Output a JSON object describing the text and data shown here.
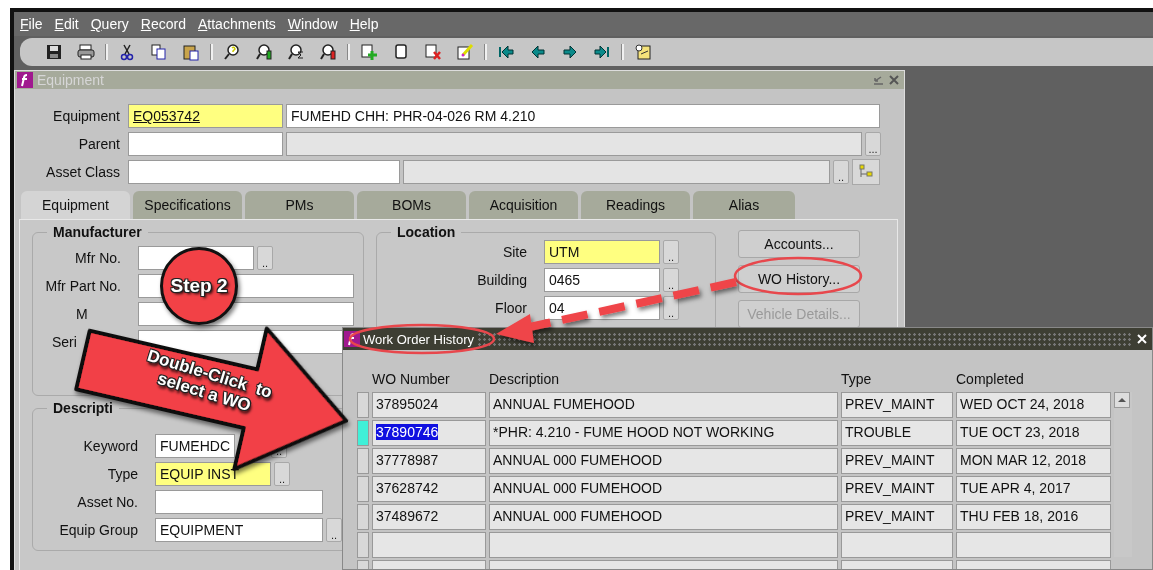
{
  "menu": [
    {
      "label": "File"
    },
    {
      "label": "Edit"
    },
    {
      "label": "Query"
    },
    {
      "label": "Record"
    },
    {
      "label": "Attachments"
    },
    {
      "label": "Window"
    },
    {
      "label": "Help"
    }
  ],
  "equipment_window": {
    "title": "Equipment",
    "header_rows": [
      {
        "label": "Equipment",
        "fields": [
          {
            "value": "EQ053742",
            "required": true,
            "disabled": false,
            "link": true
          },
          {
            "value": "FUMEHD CHH: PHR-04-026 RM 4.210",
            "required": false,
            "disabled": false
          }
        ]
      },
      {
        "label": "Parent",
        "fields": [
          {
            "required": false,
            "disabled": false
          },
          {
            "required": false,
            "disabled": true
          }
        ],
        "lov": "..."
      },
      {
        "label": "Asset Class",
        "fields": [
          {
            "required": false,
            "disabled": false
          },
          {
            "required": false,
            "disabled": true
          }
        ],
        "lov": "..",
        "tree_button": true
      }
    ],
    "tabs": [
      {
        "label": "Equipment",
        "selected": true
      },
      {
        "label": "Specifications",
        "selected": false
      },
      {
        "label": "PMs",
        "selected": false
      },
      {
        "label": "BOMs",
        "selected": false
      },
      {
        "label": "Acquisition",
        "selected": false
      },
      {
        "label": "Readings",
        "selected": false
      },
      {
        "label": "Alias",
        "selected": false
      }
    ],
    "groups": [
      {
        "title": "Manufacturer",
        "rows": [
          {
            "label": "Mfr No.",
            "required": false,
            "lov": ".."
          },
          {
            "label": "Mfr Part No.",
            "required": false
          },
          {
            "label": "M",
            "required": false
          },
          {
            "label": "Seri",
            "required": false
          }
        ]
      },
      {
        "title": "Descripti",
        "rows": [
          {
            "label": "Keyword",
            "value": "FUMEHDC",
            "required": false,
            "lov": ".."
          },
          {
            "label": "Type",
            "value": "EQUIP INST",
            "required": true,
            "lov": ".."
          },
          {
            "label": "Asset No.",
            "required": false
          },
          {
            "label": "Equip Group",
            "value": "EQUIPMENT",
            "required": false,
            "lov": ".."
          }
        ]
      }
    ],
    "location": {
      "title": "Location",
      "rows": [
        {
          "label": "Site",
          "value": "UTM",
          "required": true,
          "lov": ".."
        },
        {
          "label": "Building",
          "value": "0465",
          "required": false,
          "lov": ".."
        },
        {
          "label": "Floor",
          "value": "04",
          "required": false,
          "lov": ".."
        }
      ]
    },
    "buttons": [
      {
        "label": "Accounts...",
        "disabled": false
      },
      {
        "label": "WO History...",
        "disabled": false
      },
      {
        "label": "Vehicle Details...",
        "disabled": true
      }
    ]
  },
  "wo_history": {
    "title": "Work Order History",
    "columns": [
      "WO Number",
      "Description",
      "Type",
      "Completed"
    ],
    "rows": [
      {
        "cells": [
          "37895024",
          "ANNUAL FUMEHOOD",
          "PREV_MAINT",
          "WED OCT 24, 2018"
        ],
        "selected": false
      },
      {
        "cells": [
          "37890746",
          "*PHR: 4.210 - FUME HOOD NOT WORKING",
          "TROUBLE",
          "TUE OCT 23, 2018"
        ],
        "selected": true
      },
      {
        "cells": [
          "37778987",
          "ANNUAL 000 FUMEHOOD",
          "PREV_MAINT",
          "MON MAR 12, 2018"
        ],
        "selected": false
      },
      {
        "cells": [
          "37628742",
          "ANNUAL 000 FUMEHOOD",
          "PREV_MAINT",
          "TUE APR 4, 2017"
        ],
        "selected": false
      },
      {
        "cells": [
          "37489672",
          "ANNUAL 000 FUMEHOOD",
          "PREV_MAINT",
          "THU FEB 18, 2016"
        ],
        "selected": false
      }
    ]
  },
  "annotations": {
    "step_badge": "Step 2",
    "callout": "Double-Click  to\nselect a WO"
  }
}
